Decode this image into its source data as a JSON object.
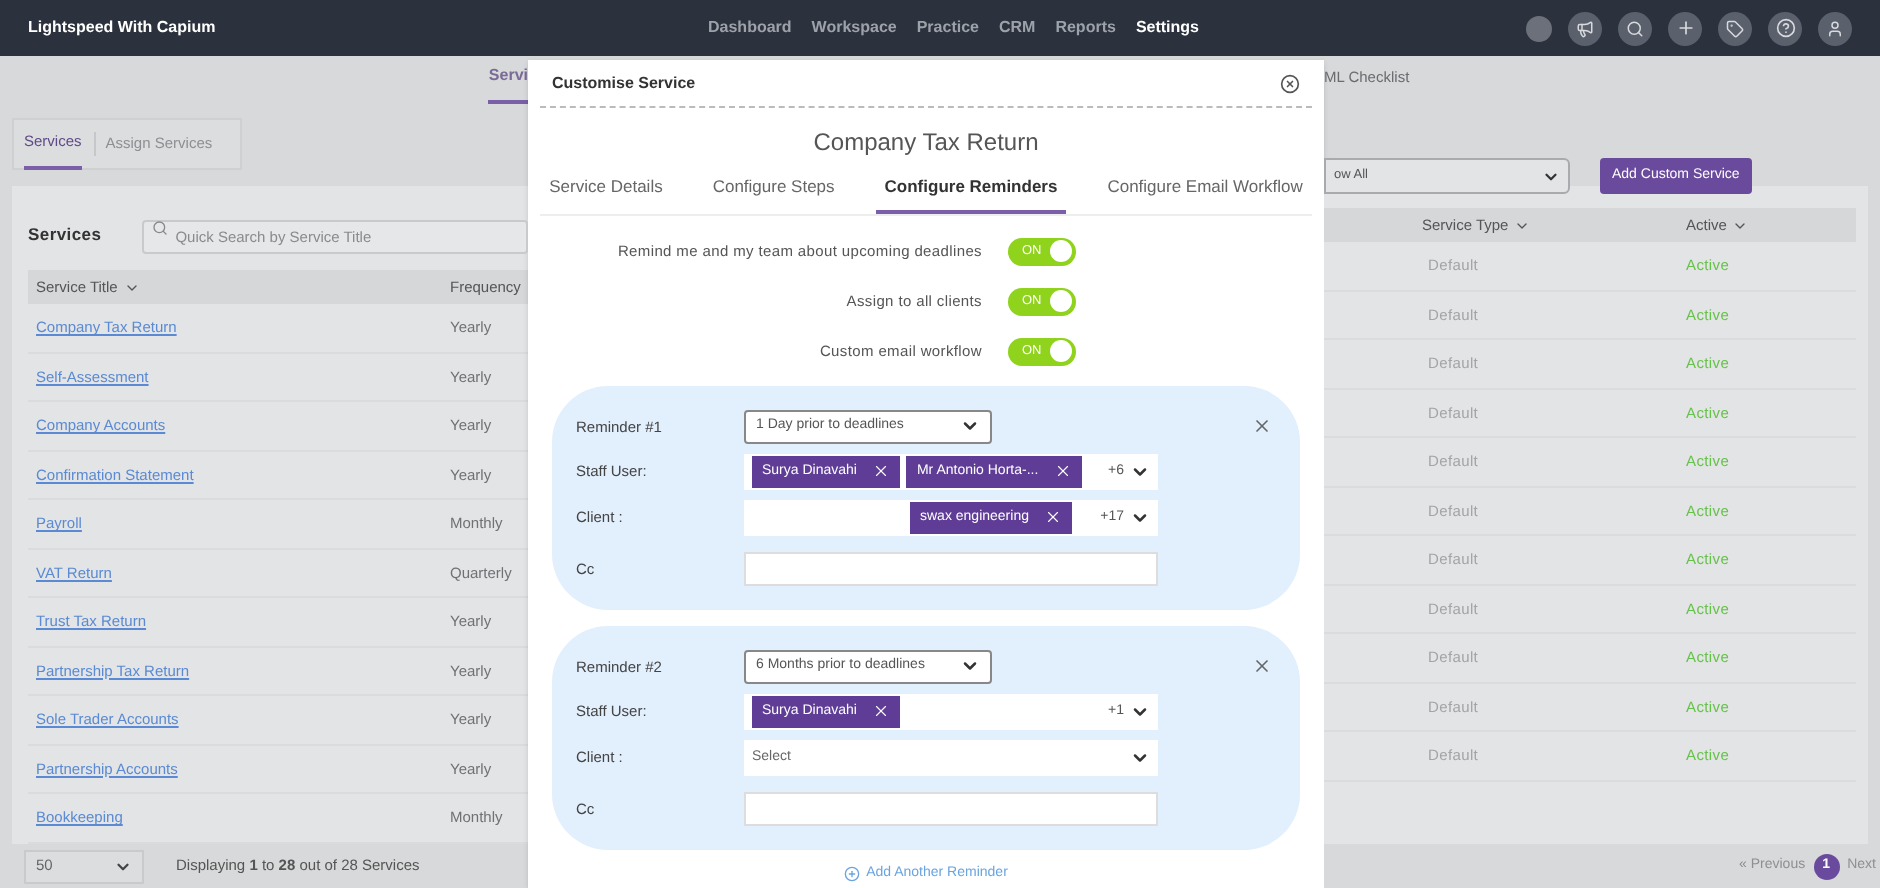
{
  "nav": {
    "brand": "Lightspeed With Capium",
    "links": [
      {
        "label": "Dashboard",
        "selected": false
      },
      {
        "label": "Workspace",
        "selected": false
      },
      {
        "label": "Practice",
        "selected": false
      },
      {
        "label": "CRM",
        "selected": false
      },
      {
        "label": "Reports",
        "selected": false
      },
      {
        "label": "Settings",
        "selected": true
      }
    ]
  },
  "subnav": {
    "left_tab": {
      "label": "Servi",
      "selected": true
    },
    "right_tab": {
      "label": "ML Checklist",
      "selected": false
    }
  },
  "page_tabs": [
    {
      "label": "Services",
      "selected": true
    },
    {
      "label": "Assign Services",
      "selected": false
    }
  ],
  "services": {
    "heading": "Services",
    "search_placeholder": "Quick Search by Service Title",
    "filter_value": "ow All",
    "add_button": "Add Custom Service",
    "columns": [
      "Service Title",
      "Frequency",
      "Service Type",
      "Active"
    ],
    "rows": [
      {
        "title": "Company Tax Return",
        "frequency": "Yearly",
        "type": "Default",
        "status": "Active"
      },
      {
        "title": "Self-Assessment",
        "frequency": "Yearly",
        "type": "Default",
        "status": "Active"
      },
      {
        "title": "Company Accounts",
        "frequency": "Yearly",
        "type": "Default",
        "status": "Active"
      },
      {
        "title": "Confirmation Statement",
        "frequency": "Yearly",
        "type": "Default",
        "status": "Active"
      },
      {
        "title": "Payroll",
        "frequency": "Monthly",
        "type": "Default",
        "status": "Active"
      },
      {
        "title": "VAT Return",
        "frequency": "Quarterly",
        "type": "Default",
        "status": "Active"
      },
      {
        "title": "Trust Tax Return",
        "frequency": "Yearly",
        "type": "Default",
        "status": "Active"
      },
      {
        "title": "Partnership Tax Return",
        "frequency": "Yearly",
        "type": "Default",
        "status": "Active"
      },
      {
        "title": "Sole Trader Accounts",
        "frequency": "Yearly",
        "type": "Default",
        "status": "Active"
      },
      {
        "title": "Partnership Accounts",
        "frequency": "Yearly",
        "type": "Default",
        "status": "Active"
      },
      {
        "title": "Bookkeeping",
        "frequency": "Monthly",
        "type": "Default",
        "status": "Active"
      }
    ],
    "page_size": "50",
    "summary": "Displaying **1** to **28** out of 28 Services",
    "pagination": {
      "previous": "« Previous",
      "pages": [
        {
          "label": "1",
          "selected": true
        }
      ],
      "next": "Next"
    }
  },
  "modal": {
    "title": "Customise Service",
    "service": "Company Tax Return",
    "tabs": [
      {
        "label": "Service Details",
        "selected": false
      },
      {
        "label": "Configure Steps",
        "selected": false
      },
      {
        "label": "Configure Reminders",
        "selected": true
      },
      {
        "label": "Configure Email Workflow",
        "selected": false
      }
    ],
    "toggles": [
      {
        "label": "Remind me and my team about upcoming deadlines",
        "on": true,
        "text": "ON"
      },
      {
        "label": "Assign to all clients",
        "on": true,
        "text": "ON"
      },
      {
        "label": "Custom email workflow",
        "on": true,
        "text": "ON"
      }
    ],
    "reminders": [
      {
        "label": "Reminder #1",
        "timing": "1 Day prior to deadlines",
        "staff_label": "Staff User:",
        "staff": [
          "Surya Dinavahi",
          "Mr Antonio Horta-..."
        ],
        "staff_more": "+6",
        "client_label": "Client :",
        "clients": [
          "swax engineering"
        ],
        "client_more": "+17",
        "cc_label": "Cc"
      },
      {
        "label": "Reminder #2",
        "timing": "6 Months prior to deadlines",
        "staff_label": "Staff User:",
        "staff": [
          "Surya Dinavahi"
        ],
        "staff_more": "+1",
        "client_label": "Client :",
        "client_placeholder": "Select",
        "cc_label": "Cc"
      }
    ],
    "add_reminder": "Add Another Reminder"
  }
}
